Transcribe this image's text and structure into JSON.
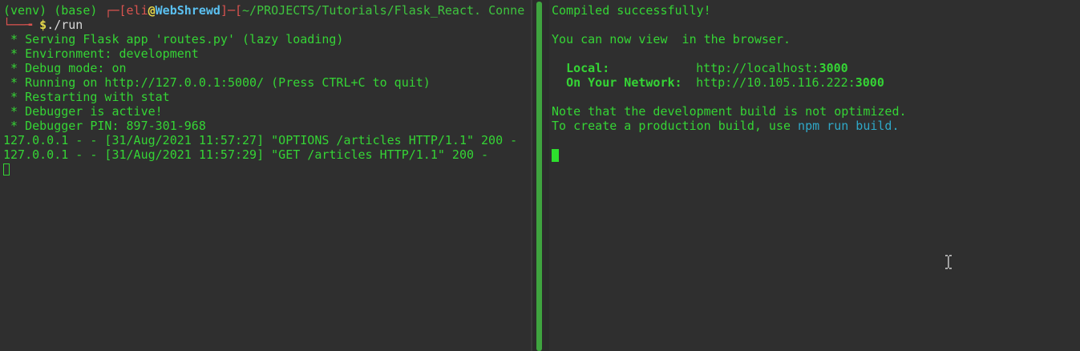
{
  "left_pane": {
    "prompt": {
      "env": "(venv) (base) ",
      "bracket_open": "┌─[",
      "user": "eli",
      "at": "@",
      "host": "WebShrewd",
      "bracket_mid": "]─[",
      "path": "~/PROJECTS/Tutorials/Flask_React. Conne",
      "line2_prefix": "└──╼ ",
      "dollar": "$",
      "command": "./run"
    },
    "output": [
      " * Serving Flask app 'routes.py' (lazy loading)",
      " * Environment: development",
      " * Debug mode: on",
      " * Running on http://127.0.0.1:5000/ (Press CTRL+C to quit)",
      " * Restarting with stat",
      " * Debugger is active!",
      " * Debugger PIN: 897-301-968",
      "127.0.0.1 - - [31/Aug/2021 11:57:27] \"OPTIONS /articles HTTP/1.1\" 200 -",
      "127.0.0.1 - - [31/Aug/2021 11:57:29] \"GET /articles HTTP/1.1\" 200 -"
    ]
  },
  "right_pane": {
    "compiled": "Compiled successfully!",
    "view_line": "You can now view  in the browser.",
    "local_label": "Local:",
    "local_url_prefix": "http://localhost:",
    "local_port": "3000",
    "network_label": "On Your Network:",
    "network_url_prefix": "http://10.105.116.222:",
    "network_port": "3000",
    "note_line": "Note that the development build is not optimized.",
    "prod_prefix": "To create a production build, use ",
    "prod_cmd": "npm run build",
    "prod_suffix": "."
  },
  "colors": {
    "background": "#2f2f2f",
    "text_green": "#35d435",
    "prompt_red": "#d9534f",
    "host_blue": "#5bc0f0",
    "cmd_cyan": "#2fa8c8",
    "scrollbar_green": "#3fa43f"
  },
  "icons": {
    "text_cursor": "i-beam-cursor-icon"
  }
}
